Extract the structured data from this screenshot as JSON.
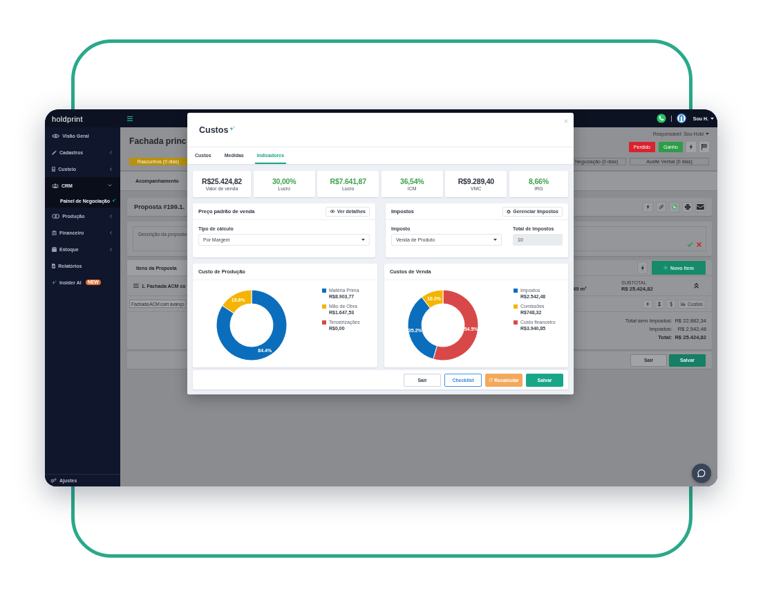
{
  "topbar": {
    "logo": "holdprint",
    "user": "Sou H."
  },
  "sidebar": {
    "items": [
      {
        "label": "Visão Geral",
        "kind": "link",
        "selected": false
      },
      {
        "label": "Cadastros",
        "kind": "group",
        "expanded": false,
        "selected": false
      },
      {
        "label": "Custeio",
        "kind": "group",
        "expanded": false,
        "selected": false
      },
      {
        "label": "CRM",
        "kind": "group",
        "expanded": true,
        "selected": false,
        "children": [
          {
            "label": "Painel de Negociação",
            "selected": true
          }
        ]
      },
      {
        "label": "Produção",
        "kind": "group",
        "expanded": false,
        "selected": false
      },
      {
        "label": "Financeiro",
        "kind": "group",
        "expanded": false,
        "selected": false
      },
      {
        "label": "Estoque",
        "kind": "group",
        "expanded": false,
        "selected": false
      },
      {
        "label": "Relatórios",
        "kind": "link",
        "selected": false
      },
      {
        "label": "Insider AI",
        "kind": "link",
        "selected": false,
        "badge": "NEW"
      }
    ],
    "footer": "Ajustes"
  },
  "page": {
    "title": "Fachada princ",
    "responsible": "Responsável: Sou Hold",
    "status_buttons": [
      {
        "label": "Perdido",
        "kind": "lost"
      },
      {
        "label": "Ganho",
        "kind": "won"
      }
    ],
    "stages": [
      {
        "label": "Rascunhos (0 dias)",
        "selected": true
      },
      {
        "label": "Negociação (0 dias)",
        "selected": false
      },
      {
        "label": "Aceite Verbal (0 dias)",
        "selected": false
      }
    ],
    "tabs": [
      {
        "label": "Acompanhamento",
        "selected": true
      }
    ],
    "proposal": {
      "title": "Proposta #199.1.",
      "placeholder": "Descrição da proposta"
    },
    "items": {
      "tabs": [
        {
          "label": "Itens da Proposta",
          "selected": true
        }
      ],
      "new_button": "Novo Item",
      "rows": [
        {
          "title": "1. Fachada ACM co",
          "area": "49 m²",
          "subtotal_label": "SUBTOTAL",
          "subtotal": "R$ 25.424,82",
          "tag": "Fachada ACM com avanço",
          "costs_button": "Custos"
        }
      ]
    },
    "totals": [
      {
        "label": "Total sem Impostos:",
        "value": "R$ 22.882,34",
        "kind": "line"
      },
      {
        "label": "Impostos:",
        "value": "R$ 2.542,48",
        "kind": "line"
      },
      {
        "label": "Total:",
        "value": "R$ 25.424,82",
        "kind": "total"
      }
    ],
    "footer_buttons": [
      {
        "label": "Sair",
        "kind": "default"
      },
      {
        "label": "Salvar",
        "kind": "primary"
      }
    ]
  },
  "modal": {
    "title": "Custos",
    "tabs": [
      {
        "label": "Custos",
        "selected": false
      },
      {
        "label": "Medidas",
        "selected": false
      },
      {
        "label": "Indicadores",
        "selected": true
      }
    ],
    "kpis": [
      {
        "value": "R$25.424,82",
        "label": "Valor de venda",
        "color": "#2c3340"
      },
      {
        "value": "30,00%",
        "label": "Lucro",
        "color": "#3ea44b"
      },
      {
        "value": "R$7.641,87",
        "label": "Lucro",
        "color": "#3ea44b"
      },
      {
        "value": "36,54%",
        "label": "ICM",
        "color": "#3ea44b"
      },
      {
        "value": "R$9.289,40",
        "label": "VMC",
        "color": "#2c3340"
      },
      {
        "value": "8,66%",
        "label": "IRG",
        "color": "#3ea44b"
      }
    ],
    "pricing": {
      "title": "Preço padrão de venda",
      "button": "Ver detalhes",
      "field_label": "Tipo de cálculo",
      "value": "Por Margem"
    },
    "taxes": {
      "title": "Impostos",
      "button": "Gerenciar Impostos",
      "tax_label": "Imposto",
      "tax_value": "Venda de Produto",
      "total_label": "Total de Impostos",
      "total_value": "10"
    },
    "charts": [
      {
        "title": "Custo de Produção",
        "legend": [
          {
            "label": "Matéria Prima",
            "amount": "R$8.903,77",
            "color": "#0a6ebd"
          },
          {
            "label": "Mão de Obra",
            "amount": "R$1.647,53",
            "color": "#f5b400"
          },
          {
            "label": "Terceirizações",
            "amount": "R$0,00",
            "color": "#d94848"
          }
        ],
        "chart_data": {
          "type": "donut",
          "values": [
            84.4,
            15.6
          ],
          "value_labels": [
            "84.4%",
            "15.6%"
          ],
          "colors": [
            "#0a6ebd",
            "#f5b400"
          ]
        }
      },
      {
        "title": "Custos de Venda",
        "legend": [
          {
            "label": "Impostos",
            "amount": "R$2.542,48",
            "color": "#0a6ebd"
          },
          {
            "label": "Comissões",
            "amount": "R$748,32",
            "color": "#f5b400"
          },
          {
            "label": "Custo financeiro",
            "amount": "R$3.940,85",
            "color": "#d94848"
          }
        ],
        "chart_data": {
          "type": "donut",
          "values": [
            54.5,
            35.2,
            10.3
          ],
          "value_labels": [
            "54.5%",
            "35.2%",
            "10.3%"
          ],
          "colors": [
            "#d94848",
            "#0a6ebd",
            "#f5b400"
          ]
        }
      }
    ],
    "buttons": [
      {
        "label": "Sair",
        "kind": "default"
      },
      {
        "label": "Checklist",
        "kind": "outline"
      },
      {
        "label": "Recalcular",
        "kind": "warning"
      },
      {
        "label": "Salvar",
        "kind": "primary"
      }
    ]
  }
}
